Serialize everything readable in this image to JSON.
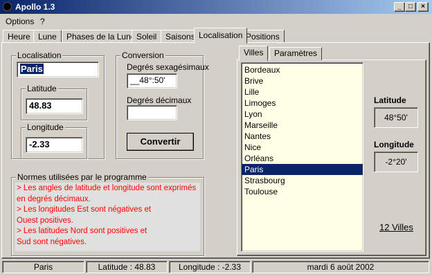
{
  "window": {
    "title": "Apollo 1.3"
  },
  "menu": {
    "options": "Options",
    "help": "?"
  },
  "tabs": [
    "Heure",
    "Lune",
    "Phases de la Lune",
    "Soleil",
    "Saisons",
    "Localisation",
    "Positions"
  ],
  "localisation": {
    "group_label": "Localisation",
    "city": "Paris",
    "latitude_label": "Latitude",
    "latitude_value": "48.83",
    "longitude_label": "Longitude",
    "longitude_value": "-2.33"
  },
  "conversion": {
    "group_label": "Conversion",
    "sexagesimal_label": "Degrés sexagésimaux",
    "sexagesimal_value": "__48°:50'",
    "decimal_label": "Degrés décimaux",
    "decimal_value": "",
    "button_label": "Convertir"
  },
  "normes": {
    "group_label": "Normes utilisées par le programme",
    "lines": [
      "> Les angles de latitude et longitude sont exprimés",
      "en degrés décimaux.",
      "> Les longitudes Est sont négatives et",
      "Ouest positives.",
      "> Les latitudes Nord sont positives et",
      "Sud sont négatives."
    ],
    "text_color": "#ff0000"
  },
  "right_panel": {
    "tabs": [
      "Villes",
      "Paramètres"
    ],
    "cities": [
      "Bordeaux",
      "Brive",
      "Lille",
      "Limoges",
      "Lyon",
      "Marseille",
      "Nantes",
      "Nice",
      "Orléans",
      "Paris",
      "Strasbourg",
      "Toulouse"
    ],
    "selected_city": "Paris",
    "latitude_label": "Latitude",
    "latitude_display": "48°50'",
    "longitude_label": "Longitude",
    "longitude_display": "-2°20'",
    "count_label": "12 Villes"
  },
  "status": {
    "city": "Paris",
    "latitude": "Latitude : 48.83",
    "longitude": "Longitude : -2.33",
    "date": "mardi 6 août 2002"
  },
  "colors": {
    "title_start": "#0a246a",
    "title_end": "#a6caf0",
    "selection": "#0a246a",
    "list_bg": "#ffffe8",
    "normes_bg": "#e0e0e0"
  }
}
